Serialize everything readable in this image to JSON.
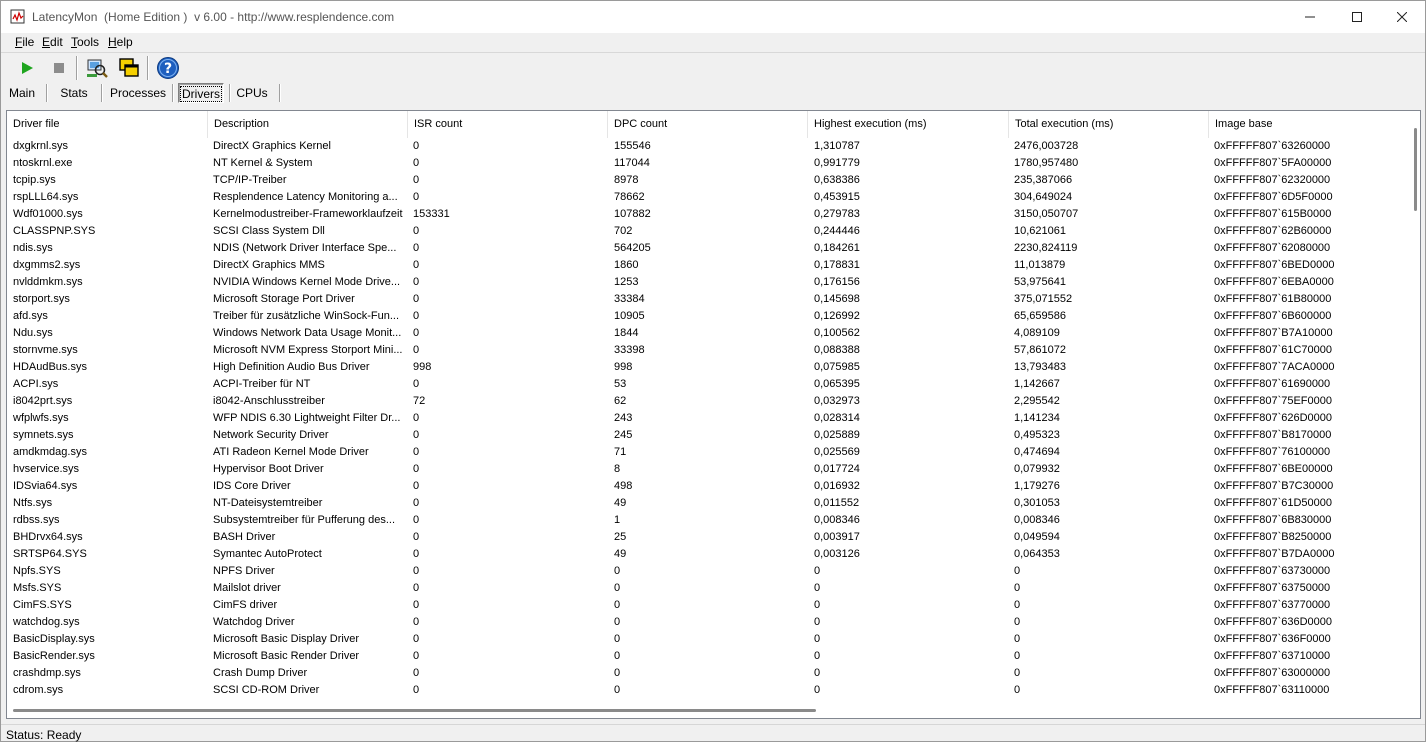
{
  "window": {
    "title": "LatencyMon  (Home Edition )  v 6.00 - http://www.resplendence.com"
  },
  "menu": {
    "items": [
      {
        "first": "F",
        "rest": "ile"
      },
      {
        "first": "E",
        "rest": "dit"
      },
      {
        "first": "T",
        "rest": "ools"
      },
      {
        "first": "H",
        "rest": "elp"
      }
    ]
  },
  "toolbar": {
    "icons": [
      "play-icon",
      "stop-icon",
      "analyze-icon",
      "windows-icon",
      "help-icon"
    ],
    "colors": {
      "play": "#1fa51f",
      "stop": "#8c8c8c",
      "help": "#1e5fbf"
    }
  },
  "tabs": [
    {
      "label": "Main"
    },
    {
      "label": "Stats"
    },
    {
      "label": "Processes"
    },
    {
      "label": "Drivers",
      "active": true
    },
    {
      "label": "CPUs"
    }
  ],
  "table": {
    "columns": [
      "Driver file",
      "Description",
      "ISR count",
      "DPC count",
      "Highest execution (ms)",
      "Total execution (ms)",
      "Image base"
    ],
    "rows": [
      [
        "dxgkrnl.sys",
        "DirectX Graphics Kernel",
        "0",
        "155546",
        "1,310787",
        "2476,003728",
        "0xFFFFF807`63260000"
      ],
      [
        "ntoskrnl.exe",
        "NT Kernel & System",
        "0",
        "117044",
        "0,991779",
        "1780,957480",
        "0xFFFFF807`5FA00000"
      ],
      [
        "tcpip.sys",
        "TCP/IP-Treiber",
        "0",
        "8978",
        "0,638386",
        "235,387066",
        "0xFFFFF807`62320000"
      ],
      [
        "rspLLL64.sys",
        "Resplendence Latency Monitoring a...",
        "0",
        "78662",
        "0,453915",
        "304,649024",
        "0xFFFFF807`6D5F0000"
      ],
      [
        "Wdf01000.sys",
        "Kernelmodustreiber-Frameworklaufzeit",
        "153331",
        "107882",
        "0,279783",
        "3150,050707",
        "0xFFFFF807`615B0000"
      ],
      [
        "CLASSPNP.SYS",
        "SCSI Class System Dll",
        "0",
        "702",
        "0,244446",
        "10,621061",
        "0xFFFFF807`62B60000"
      ],
      [
        "ndis.sys",
        "NDIS (Network Driver Interface Spe...",
        "0",
        "564205",
        "0,184261",
        "2230,824119",
        "0xFFFFF807`62080000"
      ],
      [
        "dxgmms2.sys",
        "DirectX Graphics MMS",
        "0",
        "1860",
        "0,178831",
        "11,013879",
        "0xFFFFF807`6BED0000"
      ],
      [
        "nvlddmkm.sys",
        "NVIDIA Windows Kernel Mode Drive...",
        "0",
        "1253",
        "0,176156",
        "53,975641",
        "0xFFFFF807`6EBA0000"
      ],
      [
        "storport.sys",
        "Microsoft Storage Port Driver",
        "0",
        "33384",
        "0,145698",
        "375,071552",
        "0xFFFFF807`61B80000"
      ],
      [
        "afd.sys",
        "Treiber für zusätzliche WinSock-Fun...",
        "0",
        "10905",
        "0,126992",
        "65,659586",
        "0xFFFFF807`6B600000"
      ],
      [
        "Ndu.sys",
        "Windows Network Data Usage Monit...",
        "0",
        "1844",
        "0,100562",
        "4,089109",
        "0xFFFFF807`B7A10000"
      ],
      [
        "stornvme.sys",
        "Microsoft NVM Express Storport Mini...",
        "0",
        "33398",
        "0,088388",
        "57,861072",
        "0xFFFFF807`61C70000"
      ],
      [
        "HDAudBus.sys",
        "High Definition Audio Bus Driver",
        "998",
        "998",
        "0,075985",
        "13,793483",
        "0xFFFFF807`7ACA0000"
      ],
      [
        "ACPI.sys",
        "ACPI-Treiber für NT",
        "0",
        "53",
        "0,065395",
        "1,142667",
        "0xFFFFF807`61690000"
      ],
      [
        "i8042prt.sys",
        "i8042-Anschlusstreiber",
        "72",
        "62",
        "0,032973",
        "2,295542",
        "0xFFFFF807`75EF0000"
      ],
      [
        "wfplwfs.sys",
        "WFP NDIS 6.30 Lightweight Filter Dr...",
        "0",
        "243",
        "0,028314",
        "1,141234",
        "0xFFFFF807`626D0000"
      ],
      [
        "symnets.sys",
        "Network Security Driver",
        "0",
        "245",
        "0,025889",
        "0,495323",
        "0xFFFFF807`B8170000"
      ],
      [
        "amdkmdag.sys",
        "ATI Radeon Kernel Mode Driver",
        "0",
        "71",
        "0,025569",
        "0,474694",
        "0xFFFFF807`76100000"
      ],
      [
        "hvservice.sys",
        "Hypervisor Boot Driver",
        "0",
        "8",
        "0,017724",
        "0,079932",
        "0xFFFFF807`6BE00000"
      ],
      [
        "IDSvia64.sys",
        "IDS Core Driver",
        "0",
        "498",
        "0,016932",
        "1,179276",
        "0xFFFFF807`B7C30000"
      ],
      [
        "Ntfs.sys",
        "NT-Dateisystemtreiber",
        "0",
        "49",
        "0,011552",
        "0,301053",
        "0xFFFFF807`61D50000"
      ],
      [
        "rdbss.sys",
        "Subsystemtreiber für Pufferung des...",
        "0",
        "1",
        "0,008346",
        "0,008346",
        "0xFFFFF807`6B830000"
      ],
      [
        "BHDrvx64.sys",
        "BASH Driver",
        "0",
        "25",
        "0,003917",
        "0,049594",
        "0xFFFFF807`B8250000"
      ],
      [
        "SRTSP64.SYS",
        "Symantec AutoProtect",
        "0",
        "49",
        "0,003126",
        "0,064353",
        "0xFFFFF807`B7DA0000"
      ],
      [
        "Npfs.SYS",
        "NPFS Driver",
        "0",
        "0",
        "0",
        "0",
        "0xFFFFF807`63730000"
      ],
      [
        "Msfs.SYS",
        "Mailslot driver",
        "0",
        "0",
        "0",
        "0",
        "0xFFFFF807`63750000"
      ],
      [
        "CimFS.SYS",
        "CimFS driver",
        "0",
        "0",
        "0",
        "0",
        "0xFFFFF807`63770000"
      ],
      [
        "watchdog.sys",
        "Watchdog Driver",
        "0",
        "0",
        "0",
        "0",
        "0xFFFFF807`636D0000"
      ],
      [
        "BasicDisplay.sys",
        "Microsoft Basic Display Driver",
        "0",
        "0",
        "0",
        "0",
        "0xFFFFF807`636F0000"
      ],
      [
        "BasicRender.sys",
        "Microsoft Basic Render Driver",
        "0",
        "0",
        "0",
        "0",
        "0xFFFFF807`63710000"
      ],
      [
        "crashdmp.sys",
        "Crash Dump Driver",
        "0",
        "0",
        "0",
        "0",
        "0xFFFFF807`63000000"
      ],
      [
        "cdrom.sys",
        "SCSI CD-ROM Driver",
        "0",
        "0",
        "0",
        "0",
        "0xFFFFF807`63110000"
      ]
    ]
  },
  "status": {
    "text": "Status: Ready"
  }
}
